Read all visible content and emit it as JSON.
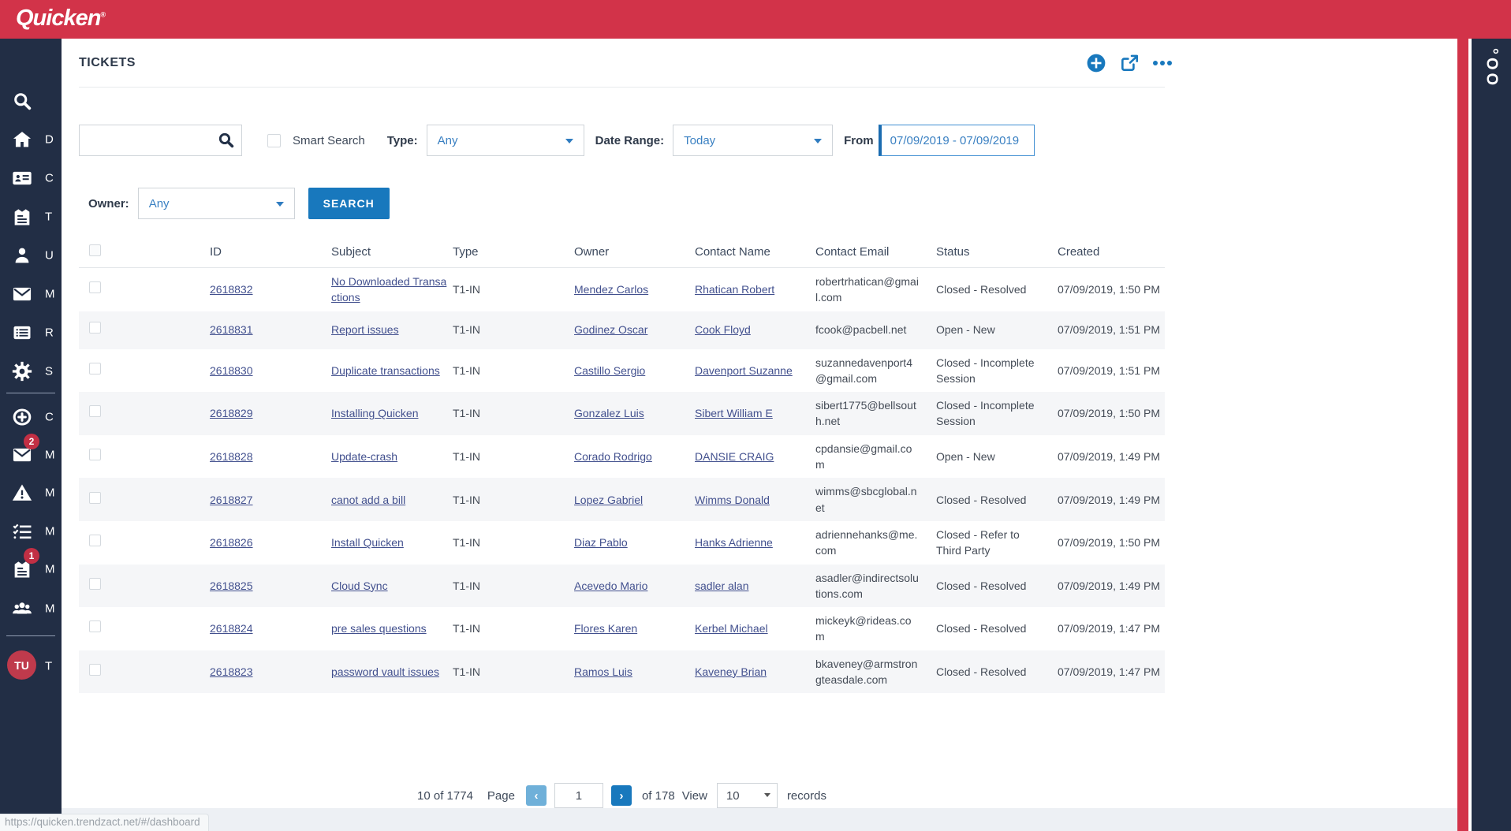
{
  "topbar": {
    "logo": "Quicken",
    "logo_mark": "®"
  },
  "sidebar": {
    "avatar_initials": "TU",
    "items": [
      {
        "icon": "search-icon",
        "letter": ""
      },
      {
        "icon": "home-icon",
        "letter": "D"
      },
      {
        "icon": "contact-card-icon",
        "letter": "C"
      },
      {
        "icon": "ticket-icon",
        "letter": "T"
      },
      {
        "icon": "user-icon",
        "letter": "U"
      },
      {
        "icon": "mail-icon",
        "letter": "M"
      },
      {
        "icon": "report-list-icon",
        "letter": "R"
      },
      {
        "icon": "settings-gear-icon",
        "letter": "S"
      },
      {
        "icon": "create-plus-icon",
        "letter": "C"
      },
      {
        "icon": "mail-icon",
        "letter": "M",
        "badge": "2"
      },
      {
        "icon": "alert-triangle-icon",
        "letter": "M"
      },
      {
        "icon": "task-list-icon",
        "letter": "M"
      },
      {
        "icon": "ticket-icon",
        "letter": "M",
        "badge": "1"
      },
      {
        "icon": "team-icon",
        "letter": "M"
      },
      {
        "icon": "user-avatar",
        "letter": "T"
      }
    ]
  },
  "right_panel": {
    "vertical_label": "°OO"
  },
  "statusbar": {
    "url": "https://quicken.trendzact.net/#/dashboard"
  },
  "page": {
    "title": "TICKETS",
    "filters": {
      "smart_search_label": "Smart Search",
      "type_label": "Type:",
      "type_value": "Any",
      "date_range_label": "Date Range:",
      "date_range_value": "Today",
      "from_label": "From",
      "from_value": "07/09/2019 - 07/09/2019",
      "owner_label": "Owner:",
      "owner_value": "Any",
      "search_button": "SEARCH"
    },
    "table": {
      "headers": [
        "ID",
        "Subject",
        "Type",
        "Owner",
        "Contact Name",
        "Contact Email",
        "Status",
        "Created"
      ],
      "rows": [
        {
          "id": "2618832",
          "subject": "No Downloaded Transactions",
          "type": "T1-IN",
          "owner": "Mendez Carlos",
          "contact_name": "Rhatican Robert",
          "contact_email": "robertrhatican@gmail.com",
          "status": "Closed - Resolved",
          "created": "07/09/2019, 1:50 PM"
        },
        {
          "id": "2618831",
          "subject": "Report issues",
          "type": "T1-IN",
          "owner": "Godinez Oscar",
          "contact_name": "Cook Floyd",
          "contact_email": "fcook@pacbell.net",
          "status": "Open - New",
          "created": "07/09/2019, 1:51 PM"
        },
        {
          "id": "2618830",
          "subject": "Duplicate transactions",
          "type": "T1-IN",
          "owner": "Castillo Sergio",
          "contact_name": "Davenport Suzanne",
          "contact_email": "suzannedavenport4@gmail.com",
          "status": "Closed - Incomplete Session",
          "created": "07/09/2019, 1:51 PM"
        },
        {
          "id": "2618829",
          "subject": "Installing Quicken",
          "type": "T1-IN",
          "owner": "Gonzalez Luis",
          "contact_name": "Sibert William E",
          "contact_email": "sibert1775@bellsouth.net",
          "status": "Closed - Incomplete Session",
          "created": "07/09/2019, 1:50 PM"
        },
        {
          "id": "2618828",
          "subject": "Update-crash",
          "type": "T1-IN",
          "owner": "Corado Rodrigo",
          "contact_name": "DANSIE CRAIG",
          "contact_email": "cpdansie@gmail.com",
          "status": "Open - New",
          "created": "07/09/2019, 1:49 PM"
        },
        {
          "id": "2618827",
          "subject": "canot add a bill",
          "type": "T1-IN",
          "owner": "Lopez Gabriel",
          "contact_name": "Wimms Donald",
          "contact_email": "wimms@sbcglobal.net",
          "status": "Closed - Resolved",
          "created": "07/09/2019, 1:49 PM"
        },
        {
          "id": "2618826",
          "subject": "Install Quicken",
          "type": "T1-IN",
          "owner": "Diaz Pablo",
          "contact_name": "Hanks Adrienne",
          "contact_email": "adriennehanks@me.com",
          "status": "Closed - Refer to Third Party",
          "created": "07/09/2019, 1:50 PM"
        },
        {
          "id": "2618825",
          "subject": "Cloud Sync",
          "type": "T1-IN",
          "owner": "Acevedo Mario",
          "contact_name": "sadler alan",
          "contact_email": "asadler@indirectsolutions.com",
          "status": "Closed - Resolved",
          "created": "07/09/2019, 1:49 PM"
        },
        {
          "id": "2618824",
          "subject": "pre sales questions",
          "type": "T1-IN",
          "owner": "Flores Karen",
          "contact_name": "Kerbel Michael",
          "contact_email": "mickeyk@rideas.com",
          "status": "Closed - Resolved",
          "created": "07/09/2019, 1:47 PM"
        },
        {
          "id": "2618823",
          "subject": "password vault issues",
          "type": "T1-IN",
          "owner": "Ramos Luis",
          "contact_name": "Kaveney Brian",
          "contact_email": "bkaveney@armstrongteasdale.com",
          "status": "Closed - Resolved",
          "created": "07/09/2019, 1:47 PM"
        }
      ]
    },
    "pagination": {
      "showing": "10 of 1774",
      "page_label": "Page",
      "page_value": "1",
      "of_label": "of 178",
      "view_label": "View",
      "view_value": "10",
      "records_label": "records"
    }
  }
}
